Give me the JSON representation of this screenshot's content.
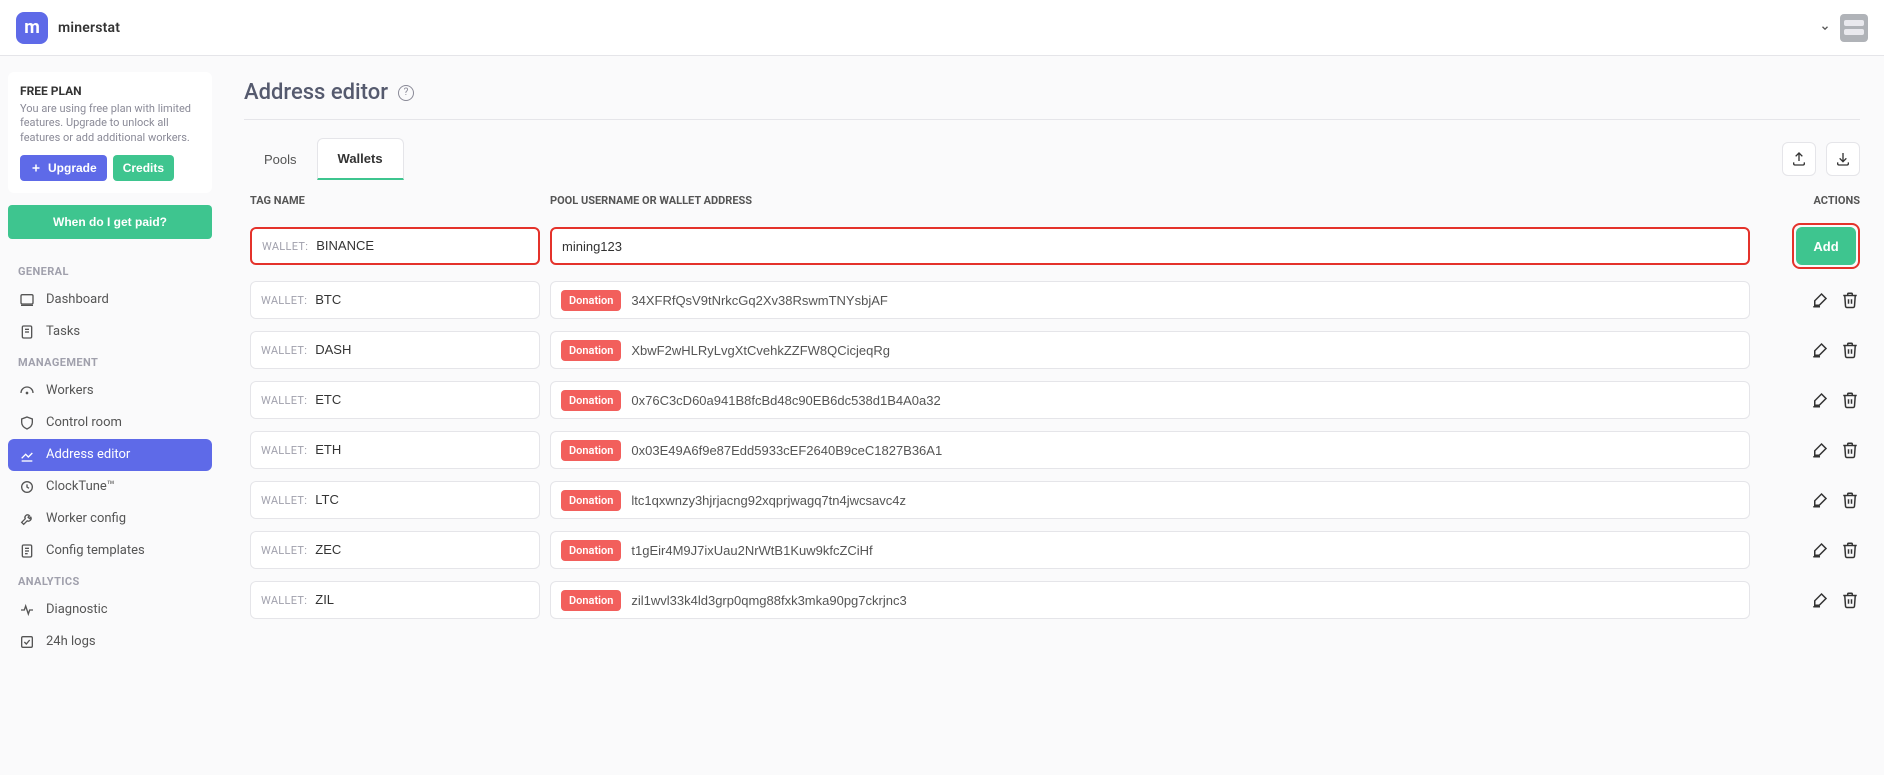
{
  "brand": "minerstat",
  "plan": {
    "title": "FREE PLAN",
    "desc": "You are using free plan with limited features. Upgrade to unlock all features or add additional workers.",
    "upgrade_label": "Upgrade",
    "credits_label": "Credits"
  },
  "paid_button": "When do I get paid?",
  "nav": {
    "section_general": "GENERAL",
    "dashboard": "Dashboard",
    "tasks": "Tasks",
    "section_management": "MANAGEMENT",
    "workers": "Workers",
    "control_room": "Control room",
    "address_editor": "Address editor",
    "clocktune": "ClockTune™",
    "worker_config": "Worker config",
    "config_templates": "Config templates",
    "section_analytics": "ANALYTICS",
    "diagnostic": "Diagnostic",
    "logs": "24h logs"
  },
  "page": {
    "title": "Address editor",
    "tabs": {
      "pools": "Pools",
      "wallets": "Wallets"
    },
    "columns": {
      "tag": "TAG NAME",
      "address": "POOL USERNAME OR WALLET ADDRESS",
      "actions": "ACTIONS"
    },
    "prefix": "WALLET:",
    "badge": "Donation",
    "add_label": "Add",
    "new_row": {
      "tag": "BINANCE",
      "address": "mining123"
    },
    "rows": [
      {
        "tag": "BTC",
        "address": "34XFRfQsV9tNrkcGq2Xv38RswmTNYsbjAF"
      },
      {
        "tag": "DASH",
        "address": "XbwF2wHLRyLvgXtCvehkZZFW8QCicjeqRg"
      },
      {
        "tag": "ETC",
        "address": "0x76C3cD60a941B8fcBd48c90EB6dc538d1B4A0a32"
      },
      {
        "tag": "ETH",
        "address": "0x03E49A6f9e87Edd5933cEF2640B9ceC1827B36A1"
      },
      {
        "tag": "LTC",
        "address": "ltc1qxwnzy3hjrjacng92xqprjwagq7tn4jwcsavc4z"
      },
      {
        "tag": "ZEC",
        "address": "t1gEir4M9J7ixUau2NrWtB1Kuw9kfcZCiHf"
      },
      {
        "tag": "ZIL",
        "address": "zil1wvl33k4ld3grp0qmg88fxk3mka90pg7ckrjnc3"
      }
    ]
  }
}
